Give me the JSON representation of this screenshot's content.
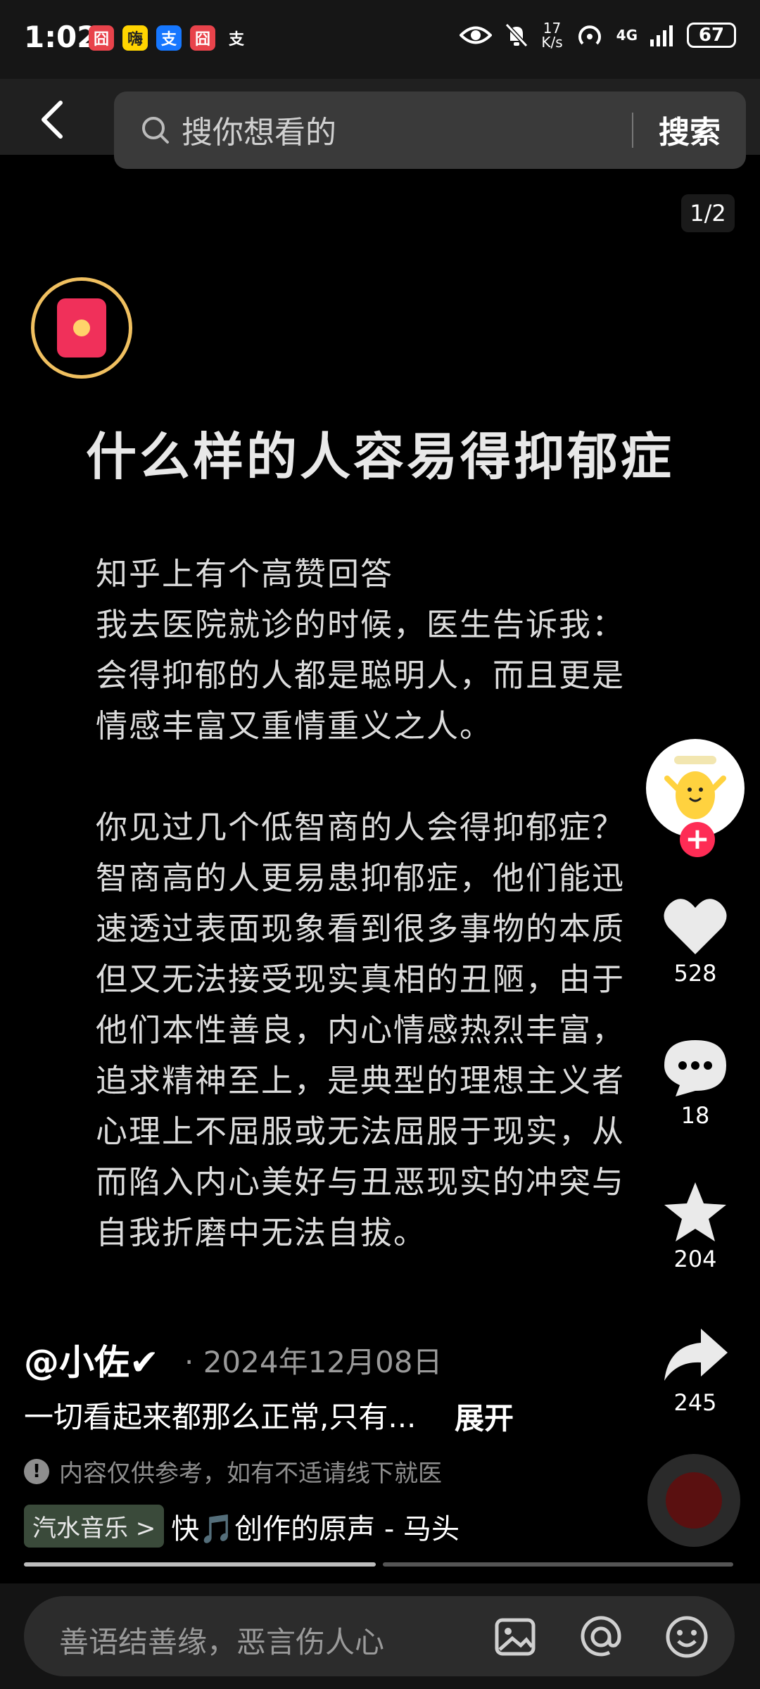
{
  "status_bar": {
    "time": "1:02",
    "net_speed_top": "17",
    "net_speed_unit": "K/s",
    "network": "4G",
    "battery": "67"
  },
  "search": {
    "placeholder": "搜你想看的",
    "button_label": "搜索"
  },
  "pager": "1/2",
  "post": {
    "headline": "什么样的人容易得抑郁症",
    "paragraph1": [
      "知乎上有个高赞回答",
      "我去医院就诊的时候，医生告诉我：",
      "会得抑郁的人都是聪明人，而且更是",
      "情感丰富又重情重义之人。"
    ],
    "paragraph2": [
      "你见过几个低智商的人会得抑郁症？",
      "智商高的人更易患抑郁症，他们能迅",
      "速透过表面现象看到很多事物的本质",
      "但又无法接受现实真相的丑陋，由于",
      "他们本性善良，内心情感热烈丰富，",
      "追求精神至上，是典型的理想主义者",
      "心理上不屈服或无法屈服于现实，从",
      "而陷入内心美好与丑恶现实的冲突与",
      "自我折磨中无法自拔。"
    ]
  },
  "actions": {
    "likes": "528",
    "comments": "18",
    "favorites": "204",
    "shares": "245"
  },
  "info": {
    "author": "@小佐✔",
    "date": "· 2024年12月08日",
    "description": "一切看起来都那么正常,只有...",
    "expand_label": "展开",
    "disclaimer": "内容仅供参考，如有不适请线下就医",
    "music_tag": "汽水音乐 >",
    "music_title": "快🎵创作的原声 - 马头"
  },
  "comment_bar": {
    "placeholder": "善语结善缘，恶言伤人心"
  },
  "colors": {
    "accent": "#fe2c55",
    "background": "#000000"
  }
}
